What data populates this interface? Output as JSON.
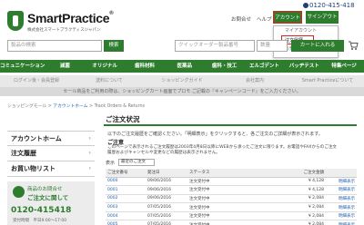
{
  "brand": {
    "name": "SmartPractice",
    "registered": "®",
    "subtitle": "株式会社スマートプラクティスジャパン"
  },
  "header": {
    "phone": "0120-415-418",
    "links": [
      "お問合せ",
      "ヘルプ"
    ],
    "account_button": "アカウント",
    "signin_button": "サインアウト",
    "account_menu": [
      "マイアカウント",
      "注文履歴",
      "お気に入り"
    ]
  },
  "search": {
    "product_placeholder": "製品の検索",
    "search_button": "検索",
    "quick_order_placeholder": "クイックオーダー製品番号",
    "qty_value": "数量",
    "add_to_cart": "カートに入れる"
  },
  "nav": {
    "items": [
      "コミュニケーション",
      "減菌",
      "オリジナル",
      "歯科材料",
      "医薬品",
      "歯科・技工",
      "エルゴデント",
      "バッヂテスト",
      "特集ページ"
    ]
  },
  "subnav": {
    "items": [
      "ログイン後・会員登録",
      "送料について",
      "ショッピングガイド",
      "会社案内",
      "Smart Practiceについて"
    ]
  },
  "notice": "セール商品をご利用の際は、ショッピングカート画面でプロモ ご記載の『キャンペーンコード』をご入力ください。",
  "breadcrumb": {
    "home": "ショッピングモール",
    "account": "アカウントホーム",
    "current": "Track Orders & Returns"
  },
  "sidebar": {
    "items": [
      "アカウントホーム",
      "注文履歴",
      "お買い物リスト"
    ],
    "banner": {
      "line1": "商品のお問合せ",
      "line2": "ご注文に関して",
      "phone": "0120-415418",
      "hours": "受付時間　平日9:00～17:00"
    }
  },
  "main": {
    "title": "ご注文状況",
    "intro": "以下のご注文履歴をご確認ください。「明細表示」をクリックすると、各ご注文のご詳細が表示されます。",
    "section_heading": "ご注意",
    "notes": [
      "このページで表示されるご注文履歴は2003年4月8日以降にWEBから承ったご注文に限ります。お電話やFAXからのご注文",
      "履歴およびキャンセルや変更などの履歴は表示されません。"
    ],
    "show_label": "表示",
    "show_value": "最近のご注文",
    "columns": [
      "ご注文番号",
      "発注日",
      "ステータス",
      "ご注文金額",
      ""
    ],
    "orders": [
      {
        "no": "0000",
        "date": "09/06/2016",
        "status": "注文受付中",
        "amount": "¥ 4,128",
        "detail": "明細表示"
      },
      {
        "no": "0001",
        "date": "09/06/2016",
        "status": "注文受付中",
        "amount": "¥ 4,128",
        "detail": "明細表示"
      },
      {
        "no": "0002",
        "date": "09/06/2016",
        "status": "注文受付中",
        "amount": "¥ 2,084",
        "detail": "明細表示"
      },
      {
        "no": "0003",
        "date": "07/05/2016",
        "status": "注文受付中",
        "amount": "¥ 2,084",
        "detail": "明細表示"
      },
      {
        "no": "0004",
        "date": "07/05/2016",
        "status": "注文受付中",
        "amount": "¥ 2,084",
        "detail": "明細表示"
      },
      {
        "no": "0005",
        "date": "07/05/2016",
        "status": "注文受付中",
        "amount": "¥ 2,084",
        "detail": "明細表示"
      }
    ]
  },
  "colors": {
    "brand_green": "#2e7d2e",
    "highlight_red": "#e02020",
    "link_blue": "#2060b0"
  }
}
